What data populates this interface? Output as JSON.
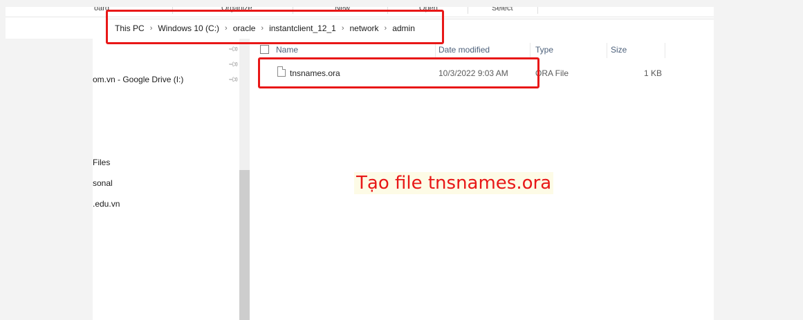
{
  "ribbon": {
    "groups": [
      "Clipboard",
      "Organize",
      "New",
      "Open",
      "Select"
    ],
    "visible_labels": [
      "oard",
      "Organize",
      "New",
      "Open",
      "Select"
    ]
  },
  "address_bar": {
    "crumbs": [
      "This PC",
      "Windows 10 (C:)",
      "oracle",
      "instantclient_12_1",
      "network",
      "admin"
    ]
  },
  "nav_pane": {
    "items": [
      {
        "label": "",
        "pinned": true
      },
      {
        "label": "",
        "pinned": true
      },
      {
        "label": "om.vn - Google Drive (I:)",
        "pinned": true
      },
      {
        "label": "Files",
        "pinned": false
      },
      {
        "label": "sonal",
        "pinned": false
      },
      {
        "label": ".edu.vn",
        "pinned": false
      }
    ]
  },
  "file_list": {
    "columns": [
      "Name",
      "Date modified",
      "Type",
      "Size"
    ],
    "rows": [
      {
        "name": "tnsnames.ora",
        "date_modified": "10/3/2022 9:03 AM",
        "type": "ORA File",
        "size": "1 KB"
      }
    ]
  },
  "annotation": {
    "callout_text": "Tạo file tnsnames.ora",
    "highlight_color": "#e81717"
  },
  "icons": {
    "pin": "pin-icon",
    "caret": "chevron-up-icon",
    "file": "file-icon",
    "separator": "chevron-right-icon"
  }
}
